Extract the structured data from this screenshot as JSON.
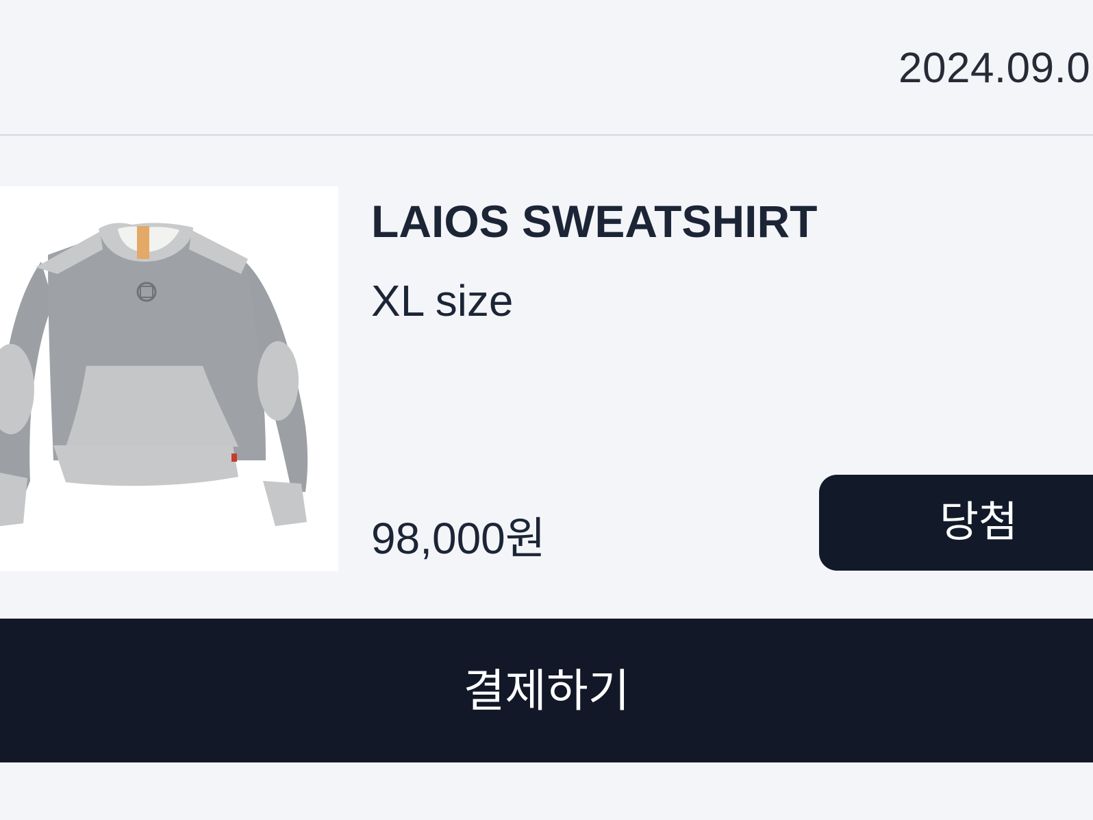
{
  "order": {
    "date": "2024.09.0"
  },
  "product": {
    "image_alt": "gray sweatshirt with light gray kangaroo pocket and elbow patches",
    "name": "LAIOS SWEATSHIRT",
    "option": "XL size",
    "price": "98,000원",
    "status": "당첨"
  },
  "actions": {
    "pay_label": "결제하기"
  },
  "colors": {
    "background": "#f4f5f8",
    "dark_navy": "#121828",
    "text": "#1c2536"
  }
}
